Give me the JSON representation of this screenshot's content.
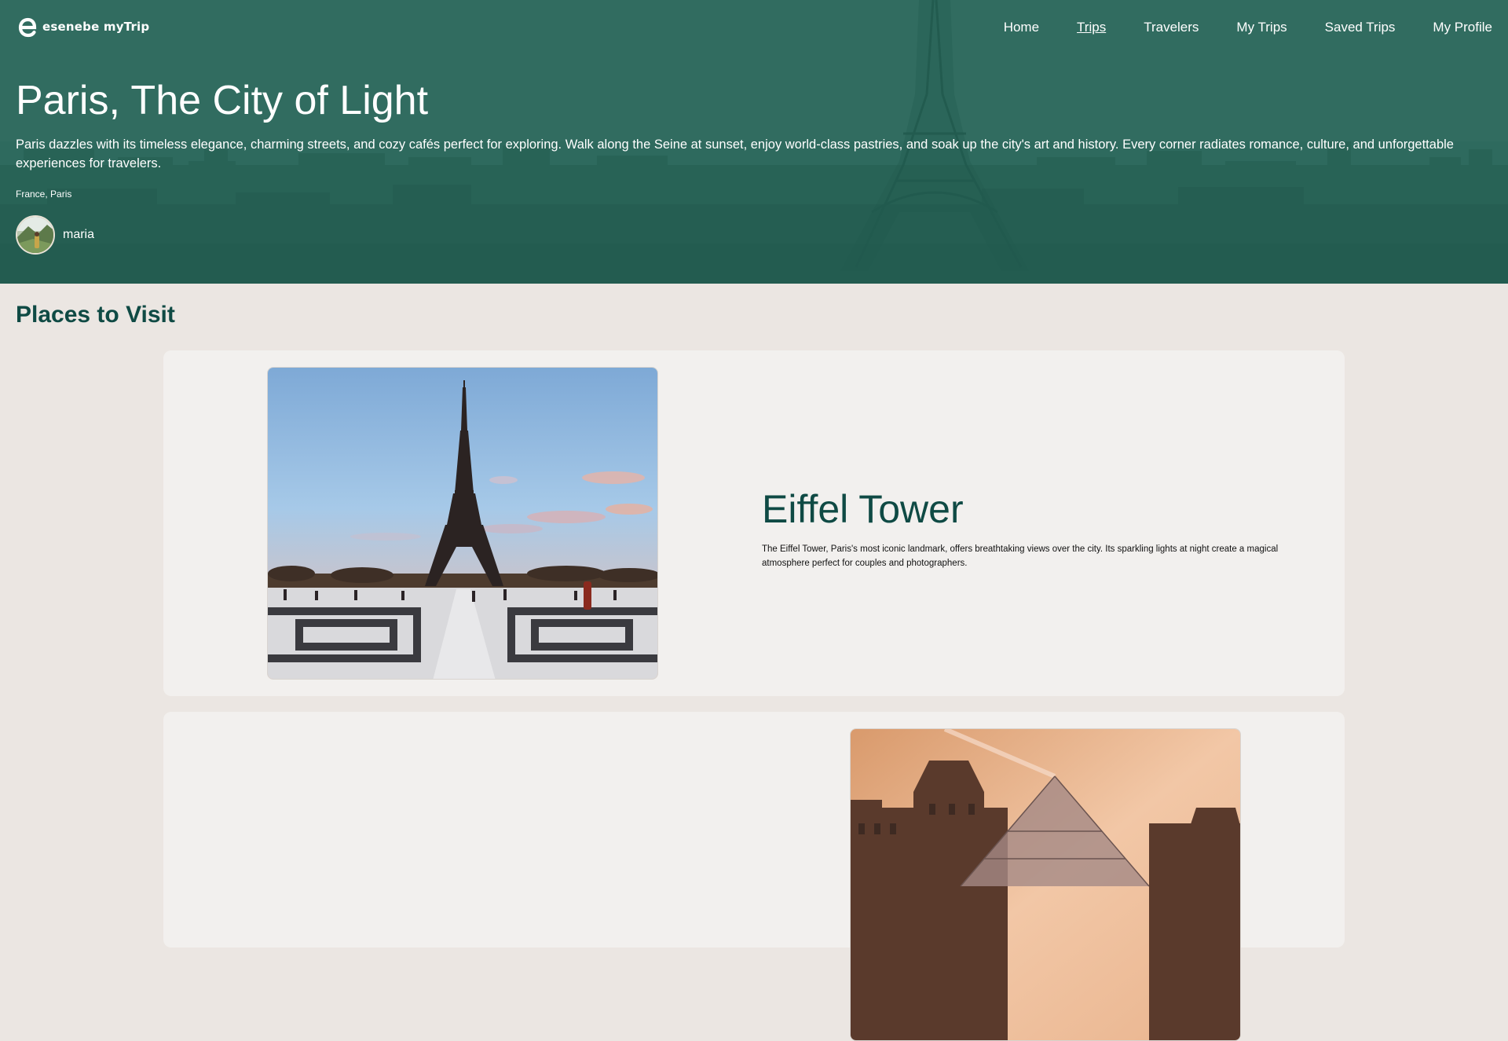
{
  "brand": {
    "name": "esenebe myTrip",
    "logo_icon": "e-logo-icon"
  },
  "nav": {
    "items": [
      {
        "label": "Home",
        "active": false
      },
      {
        "label": "Trips",
        "active": true
      },
      {
        "label": "Travelers",
        "active": false
      },
      {
        "label": "My Trips",
        "active": false
      },
      {
        "label": "Saved Trips",
        "active": false
      },
      {
        "label": "My Profile",
        "active": false
      }
    ]
  },
  "hero": {
    "title": "Paris, The City of Light",
    "description": "Paris dazzles with its timeless elegance, charming streets, and cozy cafés perfect for exploring. Walk along the Seine at sunset, enjoy world-class pastries, and soak up the city's art and history. Every corner radiates romance, culture, and unforgettable experiences for travelers.",
    "location": "France, Paris",
    "author": "maria"
  },
  "places_section": {
    "title": "Places to Visit",
    "places": [
      {
        "title": "Eiffel Tower",
        "description": "The Eiffel Tower, Paris's most iconic landmark, offers breathtaking views over the city. Its sparkling lights at night create a magical atmosphere perfect for couples and photographers.",
        "image": "eiffel-tower-photo"
      },
      {
        "title": "",
        "description": "",
        "image": "louvre-pyramid-photo"
      }
    ]
  },
  "colors": {
    "hero_overlay": "#2b6659",
    "accent": "#0f4a44",
    "page_bg": "#ebe6e2",
    "card_bg": "#f2f0ee"
  }
}
